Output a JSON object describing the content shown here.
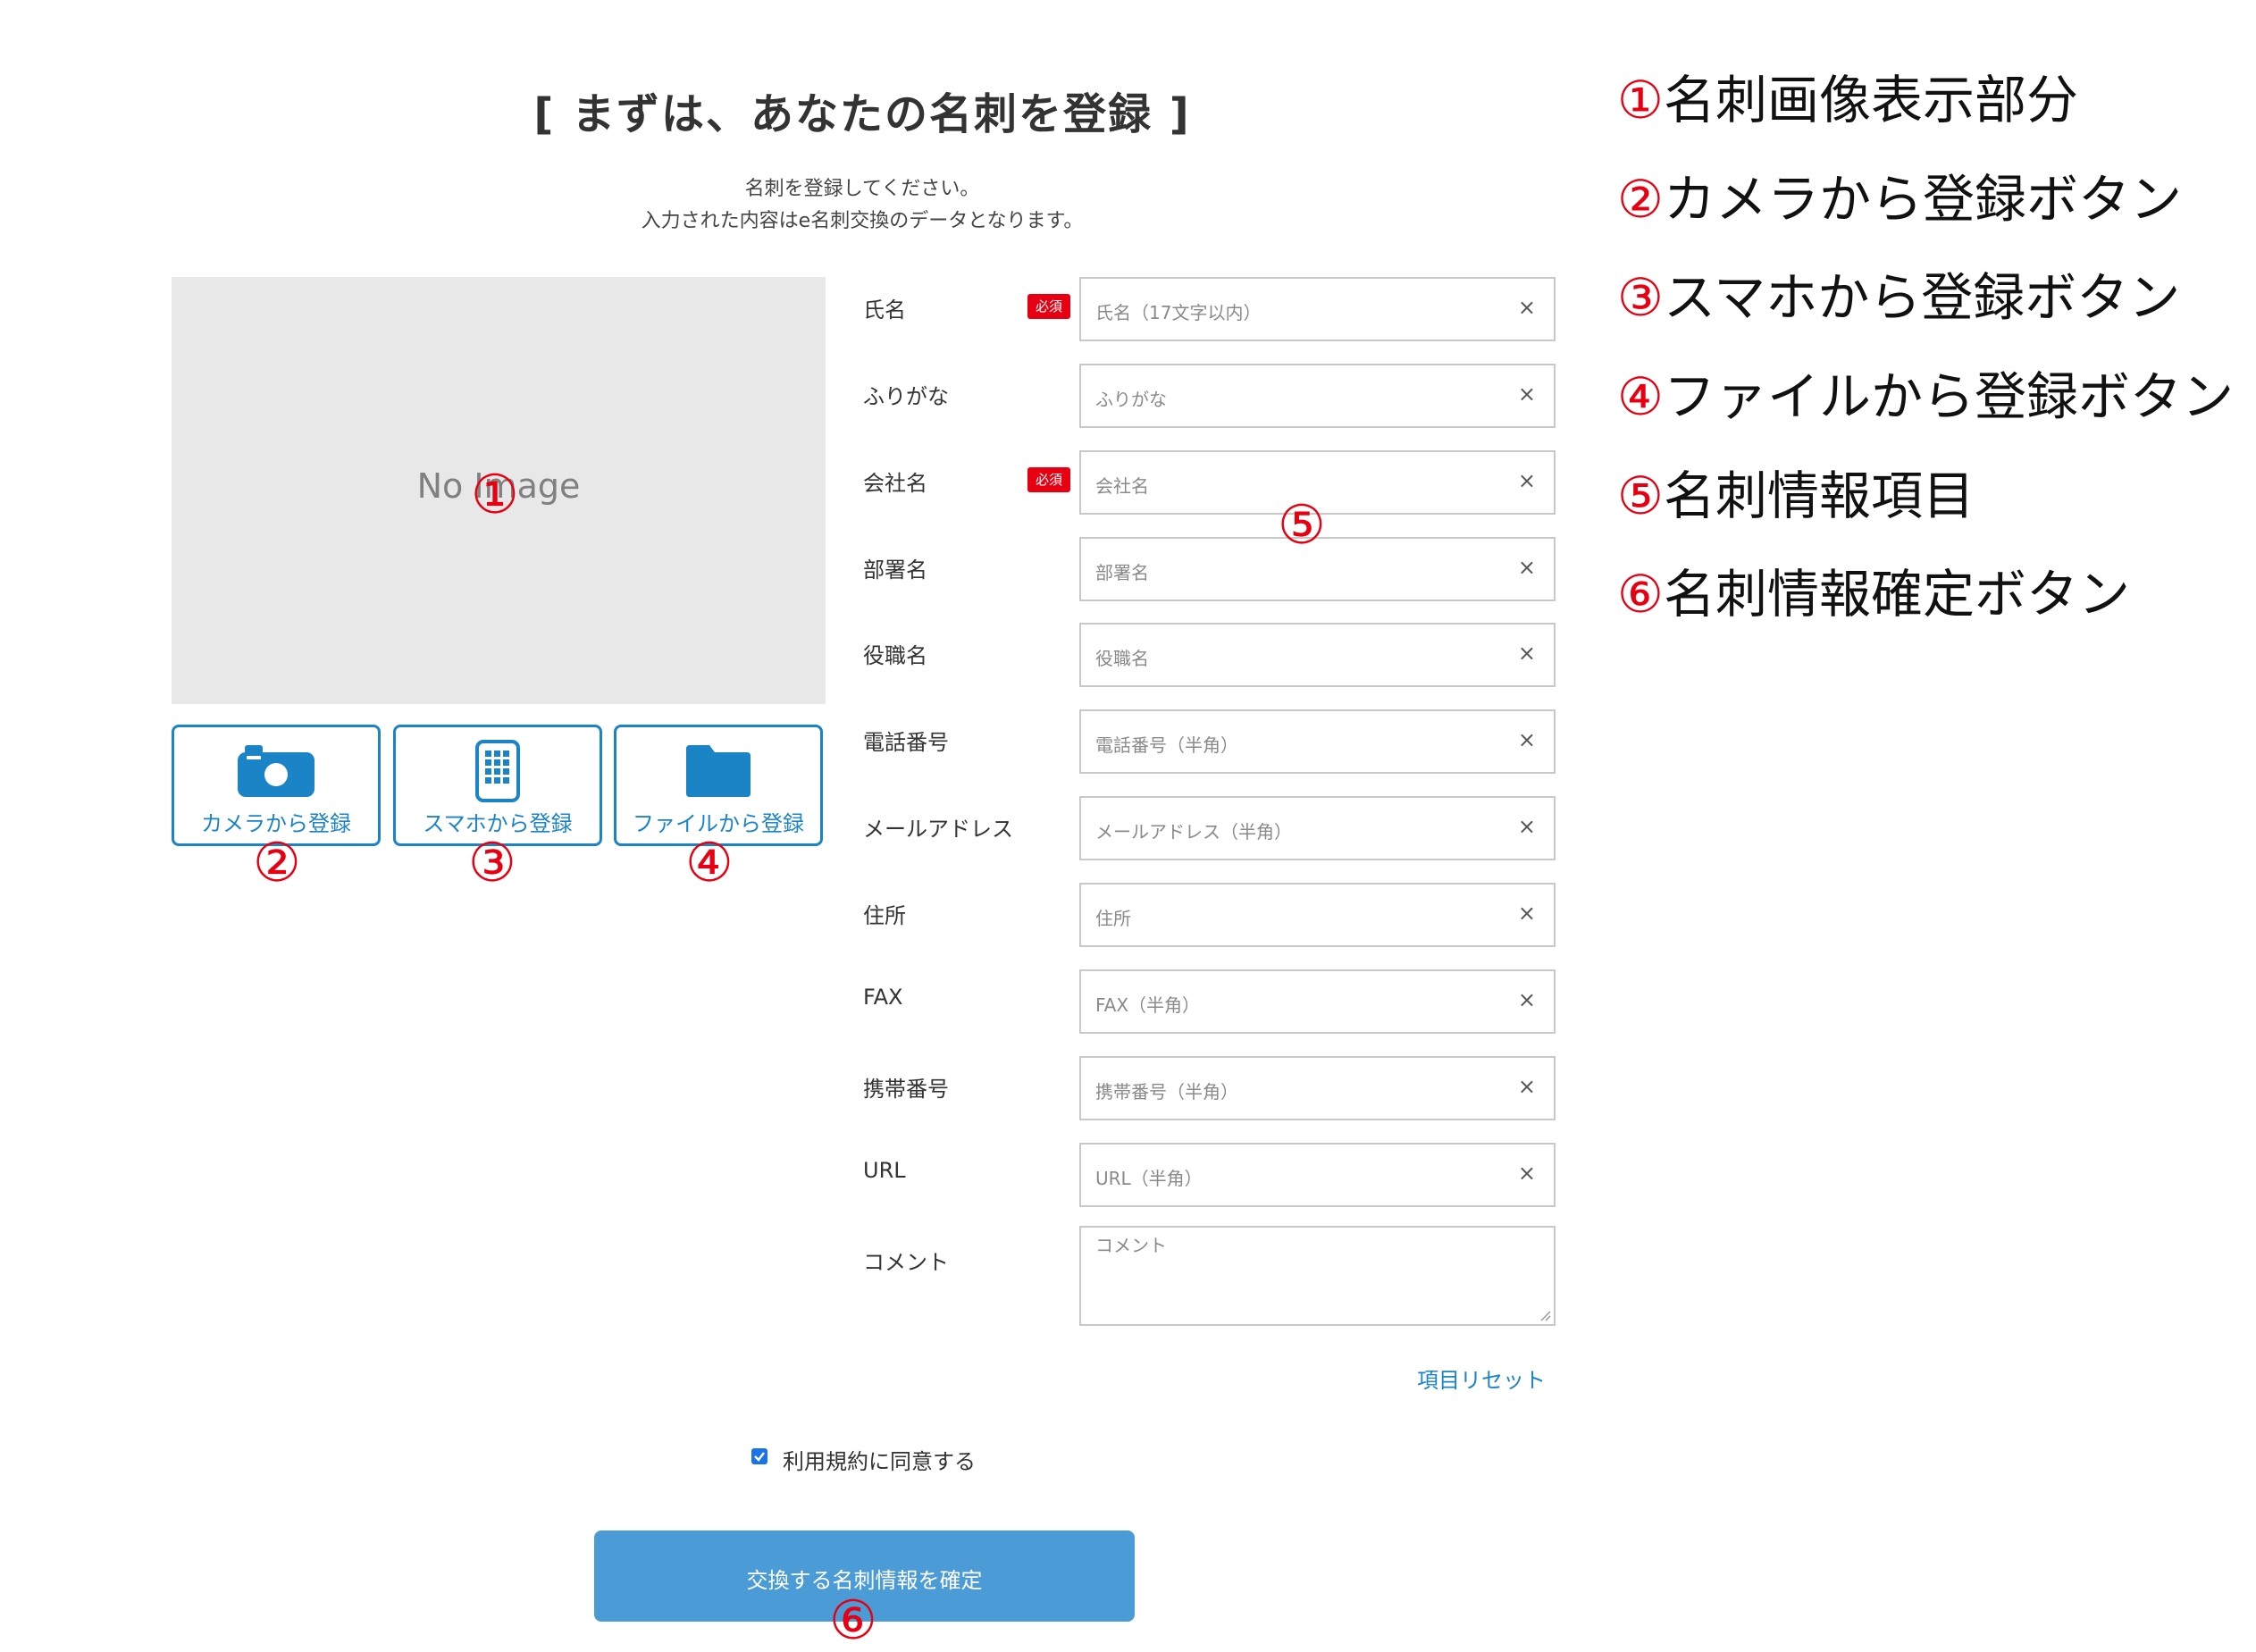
{
  "page": {
    "title": "[ まずは、あなたの名刺を登録 ]",
    "intro_line1": "名刺を登録してください。",
    "intro_line2": "入力された内容はe名刺交換のデータとなります。"
  },
  "image_panel": {
    "placeholder": "No Image"
  },
  "register_buttons": [
    {
      "label": "カメラから登録",
      "icon": "camera-icon"
    },
    {
      "label": "スマホから登録",
      "icon": "smartphone-icon"
    },
    {
      "label": "ファイルから登録",
      "icon": "folder-icon"
    }
  ],
  "required_badge": "必須",
  "clear_symbol": "×",
  "fields": [
    {
      "label": "氏名",
      "placeholder": "氏名（17文字以内）",
      "required": true
    },
    {
      "label": "ふりがな",
      "placeholder": "ふりがな",
      "required": false
    },
    {
      "label": "会社名",
      "placeholder": "会社名",
      "required": true
    },
    {
      "label": "部署名",
      "placeholder": "部署名",
      "required": false
    },
    {
      "label": "役職名",
      "placeholder": "役職名",
      "required": false
    },
    {
      "label": "電話番号",
      "placeholder": "電話番号（半角）",
      "required": false
    },
    {
      "label": "メールアドレス",
      "placeholder": "メールアドレス（半角）",
      "required": false
    },
    {
      "label": "住所",
      "placeholder": "住所",
      "required": false
    },
    {
      "label": "FAX",
      "placeholder": "FAX（半角）",
      "required": false
    },
    {
      "label": "携帯番号",
      "placeholder": "携帯番号（半角）",
      "required": false
    },
    {
      "label": "URL",
      "placeholder": "URL（半角）",
      "required": false
    }
  ],
  "comment": {
    "label": "コメント",
    "placeholder": "コメント"
  },
  "reset_link": "項目リセット",
  "terms": {
    "label": "利用規約に同意する",
    "checked": true
  },
  "confirm_button": "交換する名刺情報を確定",
  "markers": [
    "①",
    "②",
    "③",
    "④",
    "⑤",
    "⑥"
  ],
  "legend": [
    {
      "num": "①",
      "text": "名刺画像表示部分"
    },
    {
      "num": "②",
      "text": "カメラから登録ボタン"
    },
    {
      "num": "③",
      "text": "スマホから登録ボタン"
    },
    {
      "num": "④",
      "text": "ファイルから登録ボタン"
    },
    {
      "num": "⑤",
      "text": "名刺情報項目"
    },
    {
      "num": "⑥",
      "text": "名刺情報確定ボタン"
    }
  ],
  "colors": {
    "accent": "#1a84c7",
    "required_badge": "#e60012",
    "marker": "#e60012",
    "confirm_button": "#4a9bd6"
  }
}
